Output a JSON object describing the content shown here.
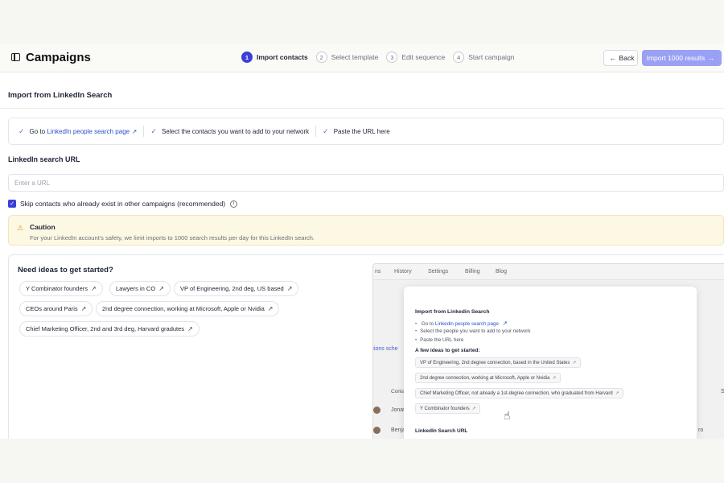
{
  "header": {
    "title": "Campaigns",
    "steps": [
      {
        "num": "1",
        "label": "Import contacts"
      },
      {
        "num": "2",
        "label": "Select template"
      },
      {
        "num": "3",
        "label": "Edit sequence"
      },
      {
        "num": "4",
        "label": "Start campaign"
      }
    ],
    "back_label": "Back",
    "import_label": "Import 1000 results"
  },
  "main": {
    "section_title": "Import from LinkedIn Search",
    "instructions": {
      "step1_prefix": "Go to",
      "step1_link": "LinkedIn people search page",
      "step2": "Select the contacts you want to add to your network",
      "step3": "Paste the URL here"
    },
    "url_label": "LinkedIn search URL",
    "url_placeholder": "Enter a URL",
    "skip_label": "Skip contacts who already exist in other campaigns (recommended)",
    "caution_title": "Caution",
    "caution_text": "For your LinkedIn account's safety, we limit imports to 1000 search results per day for this LinkedIn search."
  },
  "ideas": {
    "title": "Need ideas to get started?",
    "chips": [
      "Y Combinator founders",
      "Lawyers in CO",
      "VP of Engineering, 2nd deg, US based",
      "CEOs around Paris",
      "2nd degree connection, working at Microsoft, Apple or Nvidia",
      "Chief Marketing Officer, 2nd and 3rd deg, Harvard gradutes"
    ]
  },
  "preview": {
    "nav": [
      "ns",
      "History",
      "Settings",
      "Billing",
      "Blog"
    ],
    "bg": {
      "schedule": "tions sche",
      "contacts": "Conta",
      "row1": "Jonat",
      "row2": "Benja",
      "right_s": "S",
      "right_ro": "ro"
    },
    "modal_title": "Import from Linkedin Search",
    "bullet1_prefix": "Go to",
    "bullet1_link": "Linkedin people search page",
    "bullet2": "Select the people you want to add to your network",
    "bullet3": "Paste the URL here",
    "ideas_title": "A few ideas to get started:",
    "chips": [
      "VP of Engineering, 2nd degree connection, based in the United States",
      "2nd degree connection, working at Microsoft, Apple or Nvidia",
      "Chief Marketing Officer, not already a 1st-degree connection, who graduated from Harvard",
      "Y Combinator founders"
    ],
    "url_label": "LinkedIn Search URL"
  }
}
